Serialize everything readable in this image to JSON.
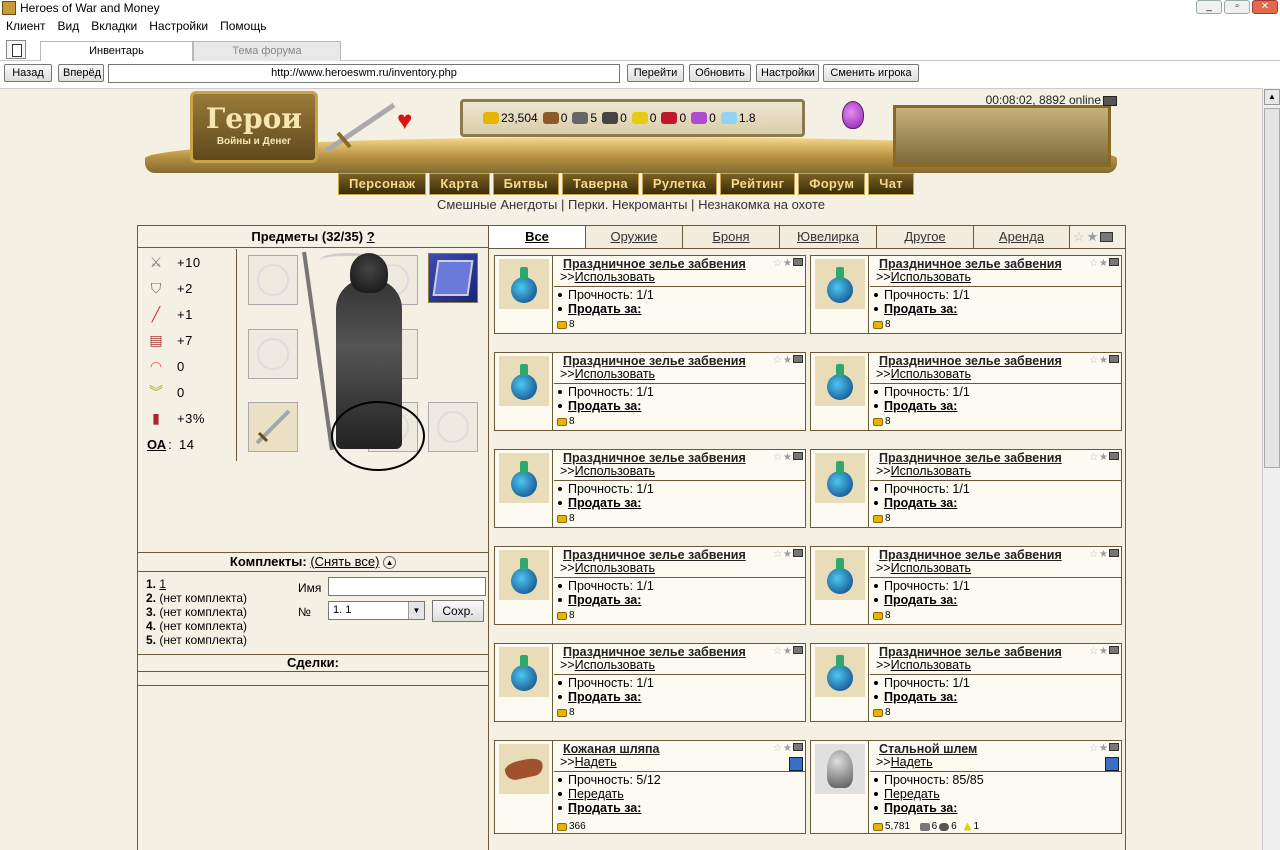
{
  "window": {
    "title": "Heroes of War and Money",
    "menu": [
      "Клиент",
      "Вид",
      "Вкладки",
      "Настройки",
      "Помощь"
    ],
    "tabs": [
      {
        "label": "Инвентарь",
        "active": true
      },
      {
        "label": "Тема форума",
        "active": false
      }
    ],
    "nav": {
      "back": "Назад",
      "forward": "Вперёд",
      "url": "http://www.heroeswm.ru/inventory.php",
      "go": "Перейти",
      "refresh": "Обновить",
      "settings": "Настройки",
      "switch_player": "Сменить игрока"
    }
  },
  "header": {
    "logo_main": "Герои",
    "logo_sub": "Войны и Денег",
    "resources": {
      "gold": "23,504",
      "wood": "0",
      "ore": "5",
      "mercury": "0",
      "sulfur": "0",
      "crystals": "0",
      "gems": "0",
      "diamonds": "1.8"
    },
    "online": "00:08:02, 8892 online",
    "menu": [
      "Персонаж",
      "Карта",
      "Битвы",
      "Таверна",
      "Рулетка",
      "Рейтинг",
      "Форум",
      "Чат"
    ],
    "news": [
      "Смешные Анегдоты",
      "Перки. Некроманты",
      "Незнакомка на охоте"
    ],
    "news_separator": "|"
  },
  "inventory": {
    "title": "Предметы (32/35)",
    "help": "?",
    "stats": [
      {
        "icon": "attack-icon",
        "value": "+10"
      },
      {
        "icon": "defense-icon",
        "value": "+2"
      },
      {
        "icon": "spellpower-icon",
        "value": "+1"
      },
      {
        "icon": "knowledge-icon",
        "value": "+7"
      },
      {
        "icon": "luck-icon",
        "value": "0"
      },
      {
        "icon": "morale-icon",
        "value": "0"
      },
      {
        "icon": "initiative-icon",
        "value": "+3%"
      }
    ],
    "oa_label": "ОА",
    "oa_value": "14",
    "sets": {
      "header": "Комплекты:",
      "remove_all": "(Снять все)",
      "list": [
        {
          "no": "1.",
          "name": "1",
          "link": true
        },
        {
          "no": "2.",
          "name": "(нет комплекта)",
          "link": false
        },
        {
          "no": "3.",
          "name": "(нет комплекта)",
          "link": false
        },
        {
          "no": "4.",
          "name": "(нет комплекта)",
          "link": false
        },
        {
          "no": "5.",
          "name": "(нет комплекта)",
          "link": false
        }
      ],
      "name_label": "Имя",
      "name_value": "",
      "no_label": "№",
      "no_selected": "1. 1",
      "save": "Сохр."
    },
    "deals": "Сделки:"
  },
  "filters": {
    "tabs": [
      "Все",
      "Оружие",
      "Броня",
      "Ювелирка",
      "Другое",
      "Аренда"
    ],
    "active": 0
  },
  "items": [
    {
      "name": "Праздничное зелье забвения",
      "action": "Использовать",
      "durability": "Прочность: 1/1",
      "transfer": "",
      "sell": "Продать за:",
      "price": "8",
      "image": "potion"
    },
    {
      "name": "Праздничное зелье забвения",
      "action": "Использовать",
      "durability": "Прочность: 1/1",
      "transfer": "",
      "sell": "Продать за:",
      "price": "8",
      "image": "potion"
    },
    {
      "name": "Праздничное зелье забвения",
      "action": "Использовать",
      "durability": "Прочность: 1/1",
      "transfer": "",
      "sell": "Продать за:",
      "price": "8",
      "image": "potion"
    },
    {
      "name": "Праздничное зелье забвения",
      "action": "Использовать",
      "durability": "Прочность: 1/1",
      "transfer": "",
      "sell": "Продать за:",
      "price": "8",
      "image": "potion"
    },
    {
      "name": "Праздничное зелье забвения",
      "action": "Использовать",
      "durability": "Прочность: 1/1",
      "transfer": "",
      "sell": "Продать за:",
      "price": "8",
      "image": "potion"
    },
    {
      "name": "Праздничное зелье забвения",
      "action": "Использовать",
      "durability": "Прочность: 1/1",
      "transfer": "",
      "sell": "Продать за:",
      "price": "8",
      "image": "potion"
    },
    {
      "name": "Праздничное зелье забвения",
      "action": "Использовать",
      "durability": "Прочность: 1/1",
      "transfer": "",
      "sell": "Продать за:",
      "price": "8",
      "image": "potion"
    },
    {
      "name": "Праздничное зелье забвения",
      "action": "Использовать",
      "durability": "Прочность: 1/1",
      "transfer": "",
      "sell": "Продать за:",
      "price": "8",
      "image": "potion"
    },
    {
      "name": "Праздничное зелье забвения",
      "action": "Использовать",
      "durability": "Прочность: 1/1",
      "transfer": "",
      "sell": "Продать за:",
      "price": "8",
      "image": "potion"
    },
    {
      "name": "Праздничное зелье забвения",
      "action": "Использовать",
      "durability": "Прочность: 1/1",
      "transfer": "",
      "sell": "Продать за:",
      "price": "8",
      "image": "potion"
    },
    {
      "name": "Кожаная шляпа",
      "action": "Надеть",
      "durability": "Прочность: 5/12",
      "transfer": "Передать",
      "sell": "Продать за:",
      "price": "366",
      "image": "hat"
    },
    {
      "name": "Стальной шлем",
      "action": "Надеть",
      "durability": "Прочность: 85/85",
      "transfer": "Передать",
      "sell": "Продать за:",
      "price": "5,781",
      "price_wood": "6",
      "price_ore": "6",
      "price_sulfur": "1",
      "image": "helm"
    }
  ],
  "arrows": ">>"
}
